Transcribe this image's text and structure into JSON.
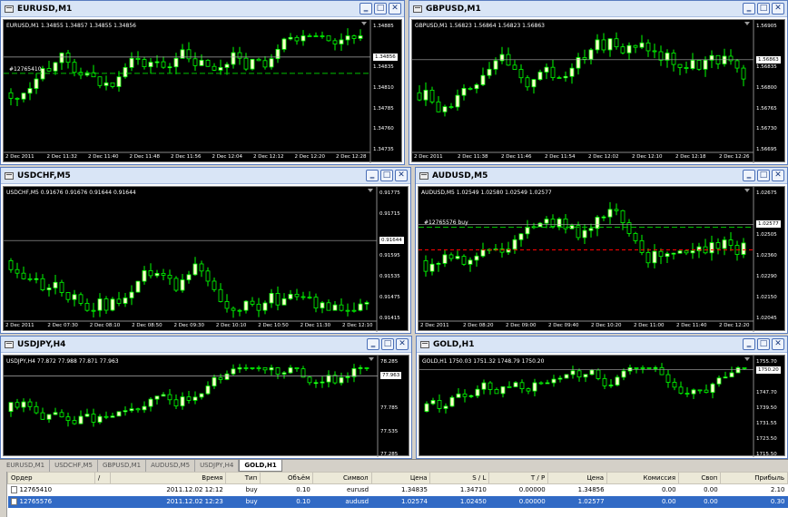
{
  "windows": [
    {
      "id": "w1",
      "title": "EURUSD,M1",
      "info": "EURUSD,M1  1.34855 1.34857 1.34855 1.34856",
      "yticks": [
        "1.34885",
        "1.34856",
        "1.34835",
        "1.34810",
        "1.34785",
        "1.34760",
        "1.34735"
      ],
      "price": "1.34856",
      "line_label": "#12765410",
      "xticks": [
        "2 Dec 2011",
        "2 Dec 11:32",
        "2 Dec 11:40",
        "2 Dec 11:48",
        "2 Dec 11:56",
        "2 Dec 12:04",
        "2 Dec 12:12",
        "2 Dec 12:20",
        "2 Dec 12:28"
      ]
    },
    {
      "id": "w2",
      "title": "GBPUSD,M1",
      "info": "GBPUSD,M1  1.56823 1.56864 1.56823 1.56863",
      "yticks": [
        "1.56905",
        "1.56863",
        "1.56835",
        "1.56800",
        "1.56765",
        "1.56730",
        "1.56695"
      ],
      "price": "1.56863",
      "line_label": "",
      "xticks": [
        "2 Dec 2011",
        "2 Dec 11:38",
        "2 Dec 11:46",
        "2 Dec 11:54",
        "2 Dec 12:02",
        "2 Dec 12:10",
        "2 Dec 12:18",
        "2 Dec 12:26"
      ]
    },
    {
      "id": "w3",
      "title": "USDCHF,M5",
      "info": "USDCHF,M5  0.91676 0.91676 0.91644 0.91644",
      "yticks": [
        "0.91775",
        "0.91715",
        "0.91644",
        "0.91595",
        "0.91535",
        "0.91475",
        "0.91415"
      ],
      "price": "0.91644",
      "line_label": "",
      "xticks": [
        "2 Dec 2011",
        "2 Dec 07:30",
        "2 Dec 08:10",
        "2 Dec 08:50",
        "2 Dec 09:30",
        "2 Dec 10:10",
        "2 Dec 10:50",
        "2 Dec 11:30",
        "2 Dec 12:10"
      ]
    },
    {
      "id": "w4",
      "title": "AUDUSD,M5",
      "info": "AUDUSD,M5  1.02549 1.02580 1.02549 1.02577",
      "yticks": [
        "1.02675",
        "1.02577",
        "1.02505",
        "1.02360",
        "1.02290",
        "1.02150",
        "1.02045"
      ],
      "price": "1.02577",
      "line_label": "#12765576 buy",
      "xticks": [
        "2 Dec 2011",
        "2 Dec 08:20",
        "2 Dec 09:00",
        "2 Dec 09:40",
        "2 Dec 10:20",
        "2 Dec 11:00",
        "2 Dec 11:40",
        "2 Dec 12:20"
      ]
    },
    {
      "id": "w5",
      "title": "USDJPY,H4",
      "info": "USDJPY,H4  77.872 77.988 77.871 77.963",
      "yticks": [
        "78.285",
        "77.963",
        "77.785",
        "77.535",
        "77.285"
      ],
      "price": "77.963",
      "line_label": "",
      "xticks": []
    },
    {
      "id": "w6",
      "title": "GOLD,H1",
      "info": "GOLD,H1  1750.03 1751.32 1748.79 1750.20",
      "yticks": [
        "1755.70",
        "1750.20",
        "1747.70",
        "1739.50",
        "1731.55",
        "1723.50",
        "1715.50"
      ],
      "price": "1750.20",
      "line_label": "",
      "xticks": []
    }
  ],
  "window_buttons": {
    "minimize": "‗",
    "maximize": "□",
    "close": "✕"
  },
  "tabs": [
    "EURUSD,M1",
    "USDCHF,M5",
    "GBPUSD,M1",
    "AUDUSD,M5",
    "USDJPY,H4",
    "GOLD,H1"
  ],
  "active_tab": "GOLD,H1",
  "terminal": {
    "side_label": "Терминал",
    "columns": [
      "Ордер",
      "/",
      "Время",
      "Тип",
      "Объём",
      "Символ",
      "Цена",
      "S / L",
      "T / P",
      "Цена",
      "Комиссия",
      "Своп",
      "Прибыль"
    ],
    "rows": [
      [
        "12765410",
        "",
        "2011.12.02 12:12",
        "buy",
        "0.10",
        "eurusd",
        "1.34835",
        "1.34710",
        "0.00000",
        "1.34856",
        "0.00",
        "0.00",
        "2.10"
      ],
      [
        "12765576",
        "",
        "2011.12.02 12:23",
        "buy",
        "0.10",
        "audusd",
        "1.02574",
        "1.02450",
        "0.00000",
        "1.02577",
        "0.00",
        "0.00",
        "0.30"
      ]
    ]
  },
  "colors": {
    "chart_bg": "#000000",
    "bull": "#ffffcc",
    "bear": "#000000",
    "wick": "#00ff00",
    "selected_row": "#316ac5"
  }
}
